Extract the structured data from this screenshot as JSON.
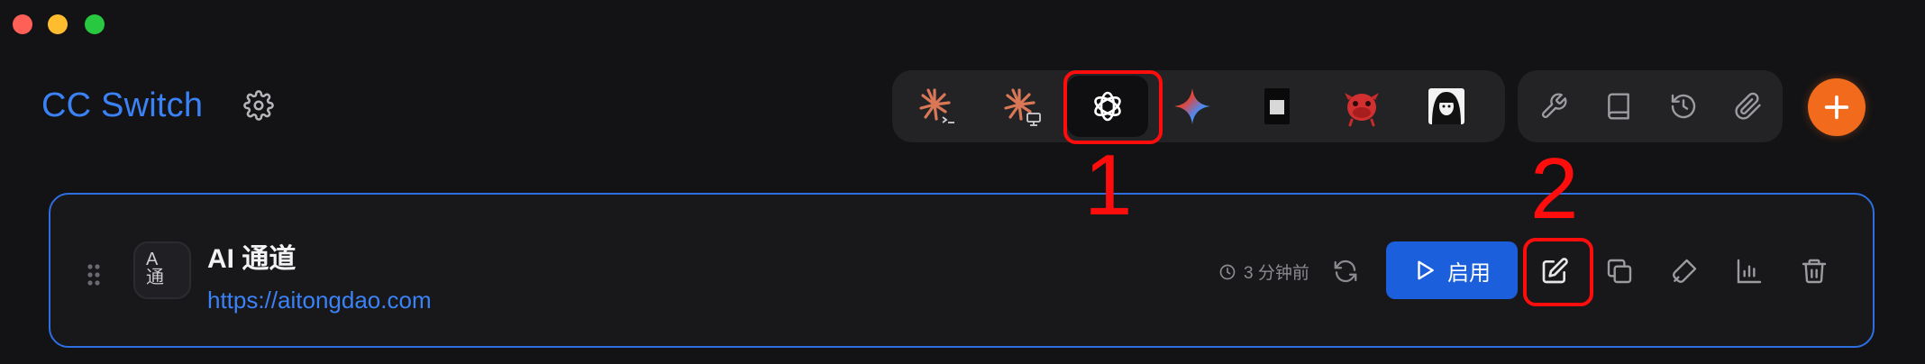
{
  "window": {
    "buttons": [
      "close",
      "minimize",
      "zoom"
    ]
  },
  "header": {
    "title": "CC Switch",
    "settings_icon": "gear-icon"
  },
  "app_switcher": {
    "items": [
      {
        "name": "claude-code",
        "icon": "claude-terminal-icon",
        "active": false
      },
      {
        "name": "claude-desktop",
        "icon": "claude-desktop-icon",
        "active": false
      },
      {
        "name": "codex",
        "icon": "openai-icon",
        "active": true
      },
      {
        "name": "gemini",
        "icon": "gemini-icon",
        "active": false
      },
      {
        "name": "app-5",
        "icon": "square-app-icon",
        "active": false
      },
      {
        "name": "app-6",
        "icon": "red-creature-icon",
        "active": false
      },
      {
        "name": "app-7",
        "icon": "portrait-app-icon",
        "active": false
      }
    ]
  },
  "toolbar": {
    "items": [
      "wrench-icon",
      "book-icon",
      "history-icon",
      "paperclip-icon"
    ],
    "add_icon": "plus-icon"
  },
  "annotations": [
    {
      "label": "1"
    },
    {
      "label": "2"
    }
  ],
  "provider": {
    "avatar_text": "A\n通",
    "name": "AI 通道",
    "url": "https://aitongdao.com",
    "last_used": "3 分钟前",
    "enable_label": "启用"
  },
  "colors": {
    "accent": "#3b82f6",
    "enable_button": "#1c5fdc",
    "add_button": "#f26b1d",
    "annotation": "#ff0d0d",
    "card_border": "#2d6fe0"
  }
}
